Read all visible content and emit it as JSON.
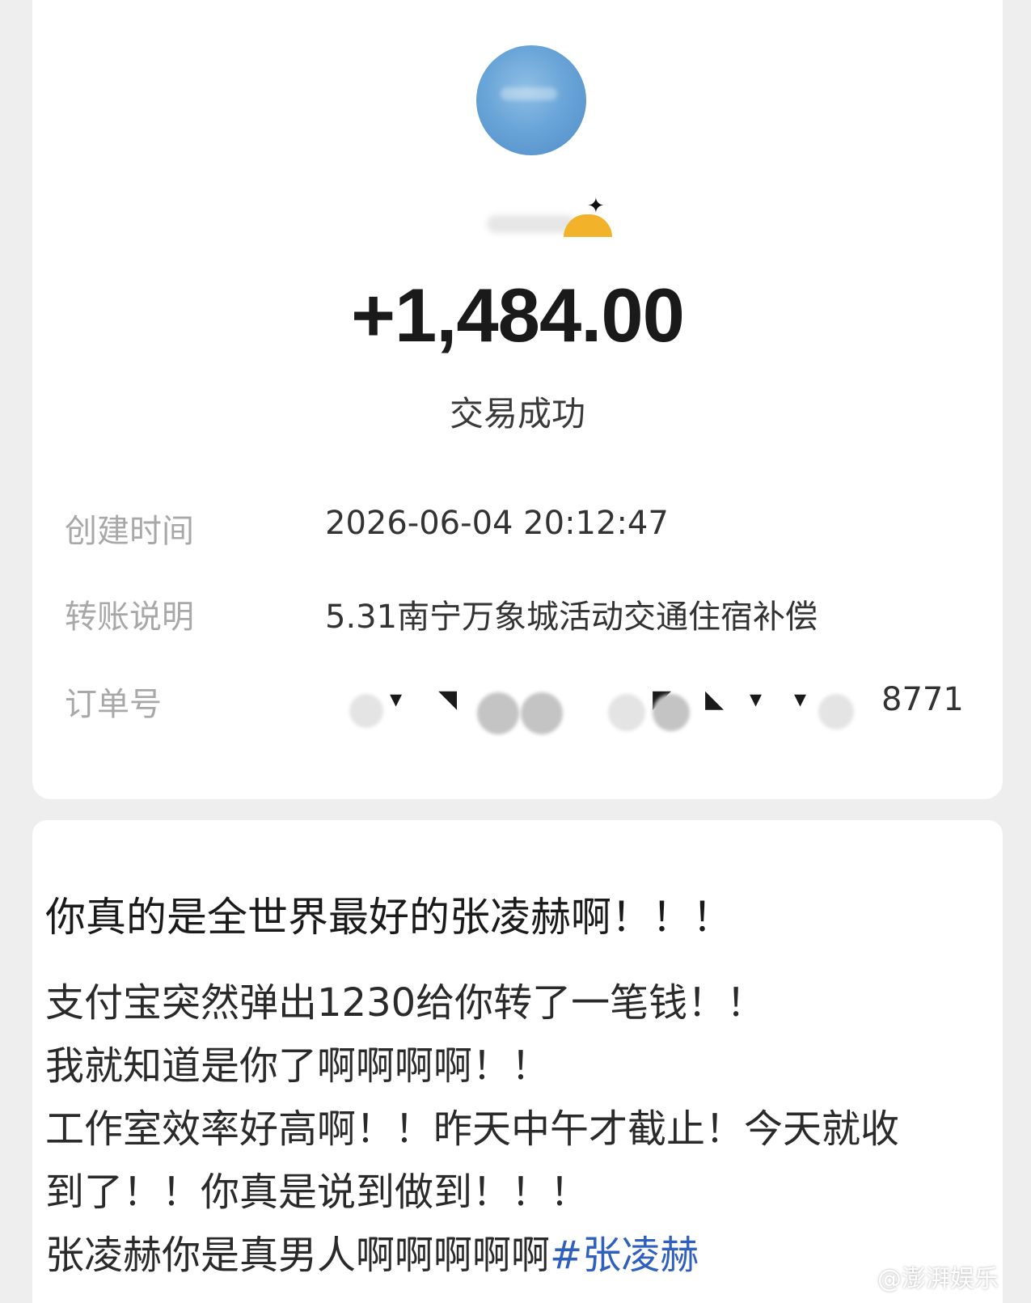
{
  "receipt": {
    "amount": "+1,484.00",
    "status": "交易成功",
    "details": [
      {
        "label": "创建时间",
        "value": "2026-06-04 20:12:47"
      },
      {
        "label": "转账说明",
        "value": "5.31南宁万象城活动交通住宿补偿"
      },
      {
        "label": "订单号",
        "value": "8771"
      }
    ]
  },
  "post": {
    "title": "你真的是全世界最好的张凌赫啊！！！",
    "lines": [
      "支付宝突然弹出1230给你转了一笔钱！！",
      "我就知道是你了啊啊啊啊！！",
      "工作室效率好高啊！！昨天中午才截止！今天就收",
      "到了！！你真是说到做到！！！",
      "张凌赫你是真男人啊啊啊啊啊"
    ],
    "hashtag": "#张凌赫"
  },
  "watermark": {
    "text": "@澎湃娱乐",
    "icon": "weibo-icon"
  },
  "colors": {
    "hashtag": "#2f5fbf",
    "label_gray": "#a8a8a8",
    "avatar_blue": "#6aa5d8",
    "badge_orange": "#f2b32b"
  }
}
